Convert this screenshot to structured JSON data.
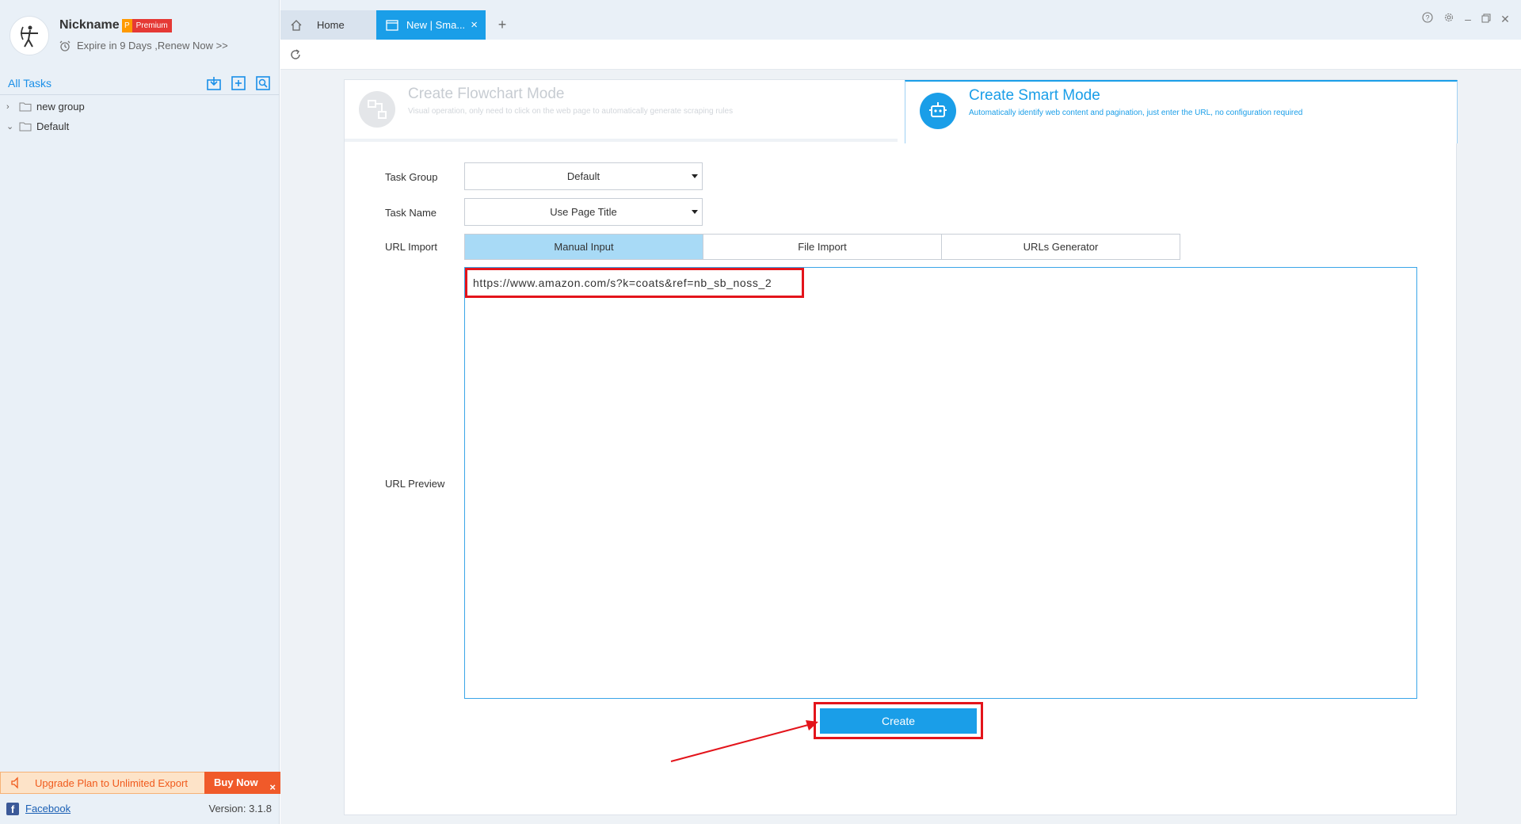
{
  "profile": {
    "nickname": "Nickname",
    "badge_letter": "P",
    "badge_label": "Premium",
    "expire_text": "Expire in 9 Days ,Renew Now >>"
  },
  "sidebar": {
    "all_tasks": "All Tasks",
    "tree": [
      {
        "label": "new group",
        "expanded": false
      },
      {
        "label": "Default",
        "expanded": true
      }
    ],
    "upgrade_text": "Upgrade Plan to Unlimited Export",
    "buy_now": "Buy Now",
    "close_glyph": "×",
    "facebook": "Facebook",
    "version": "Version: 3.1.8"
  },
  "tabs": {
    "home": "Home",
    "new_tab": "New | Sma...",
    "close_glyph": "×",
    "add_glyph": "+"
  },
  "modes": {
    "flowchart_title": "Create Flowchart Mode",
    "flowchart_desc": "Visual operation, only need to click on the web page to automatically generate scraping rules",
    "smart_title": "Create Smart Mode",
    "smart_desc": "Automatically identify web content and pagination, just enter the URL, no configuration required"
  },
  "form": {
    "task_group_label": "Task Group",
    "task_group_value": "Default",
    "task_name_label": "Task Name",
    "task_name_value": "Use Page Title",
    "url_import_label": "URL Import",
    "import_tabs": [
      "Manual Input",
      "File Import",
      "URLs Generator"
    ],
    "url_preview_label": "URL Preview",
    "url_value": "https://www.amazon.com/s?k=coats&ref=nb_sb_noss_2",
    "create_button": "Create"
  },
  "colors": {
    "accent": "#1a9ee8",
    "highlight": "#e3141b",
    "sidebar_bg": "#e9f0f7"
  }
}
